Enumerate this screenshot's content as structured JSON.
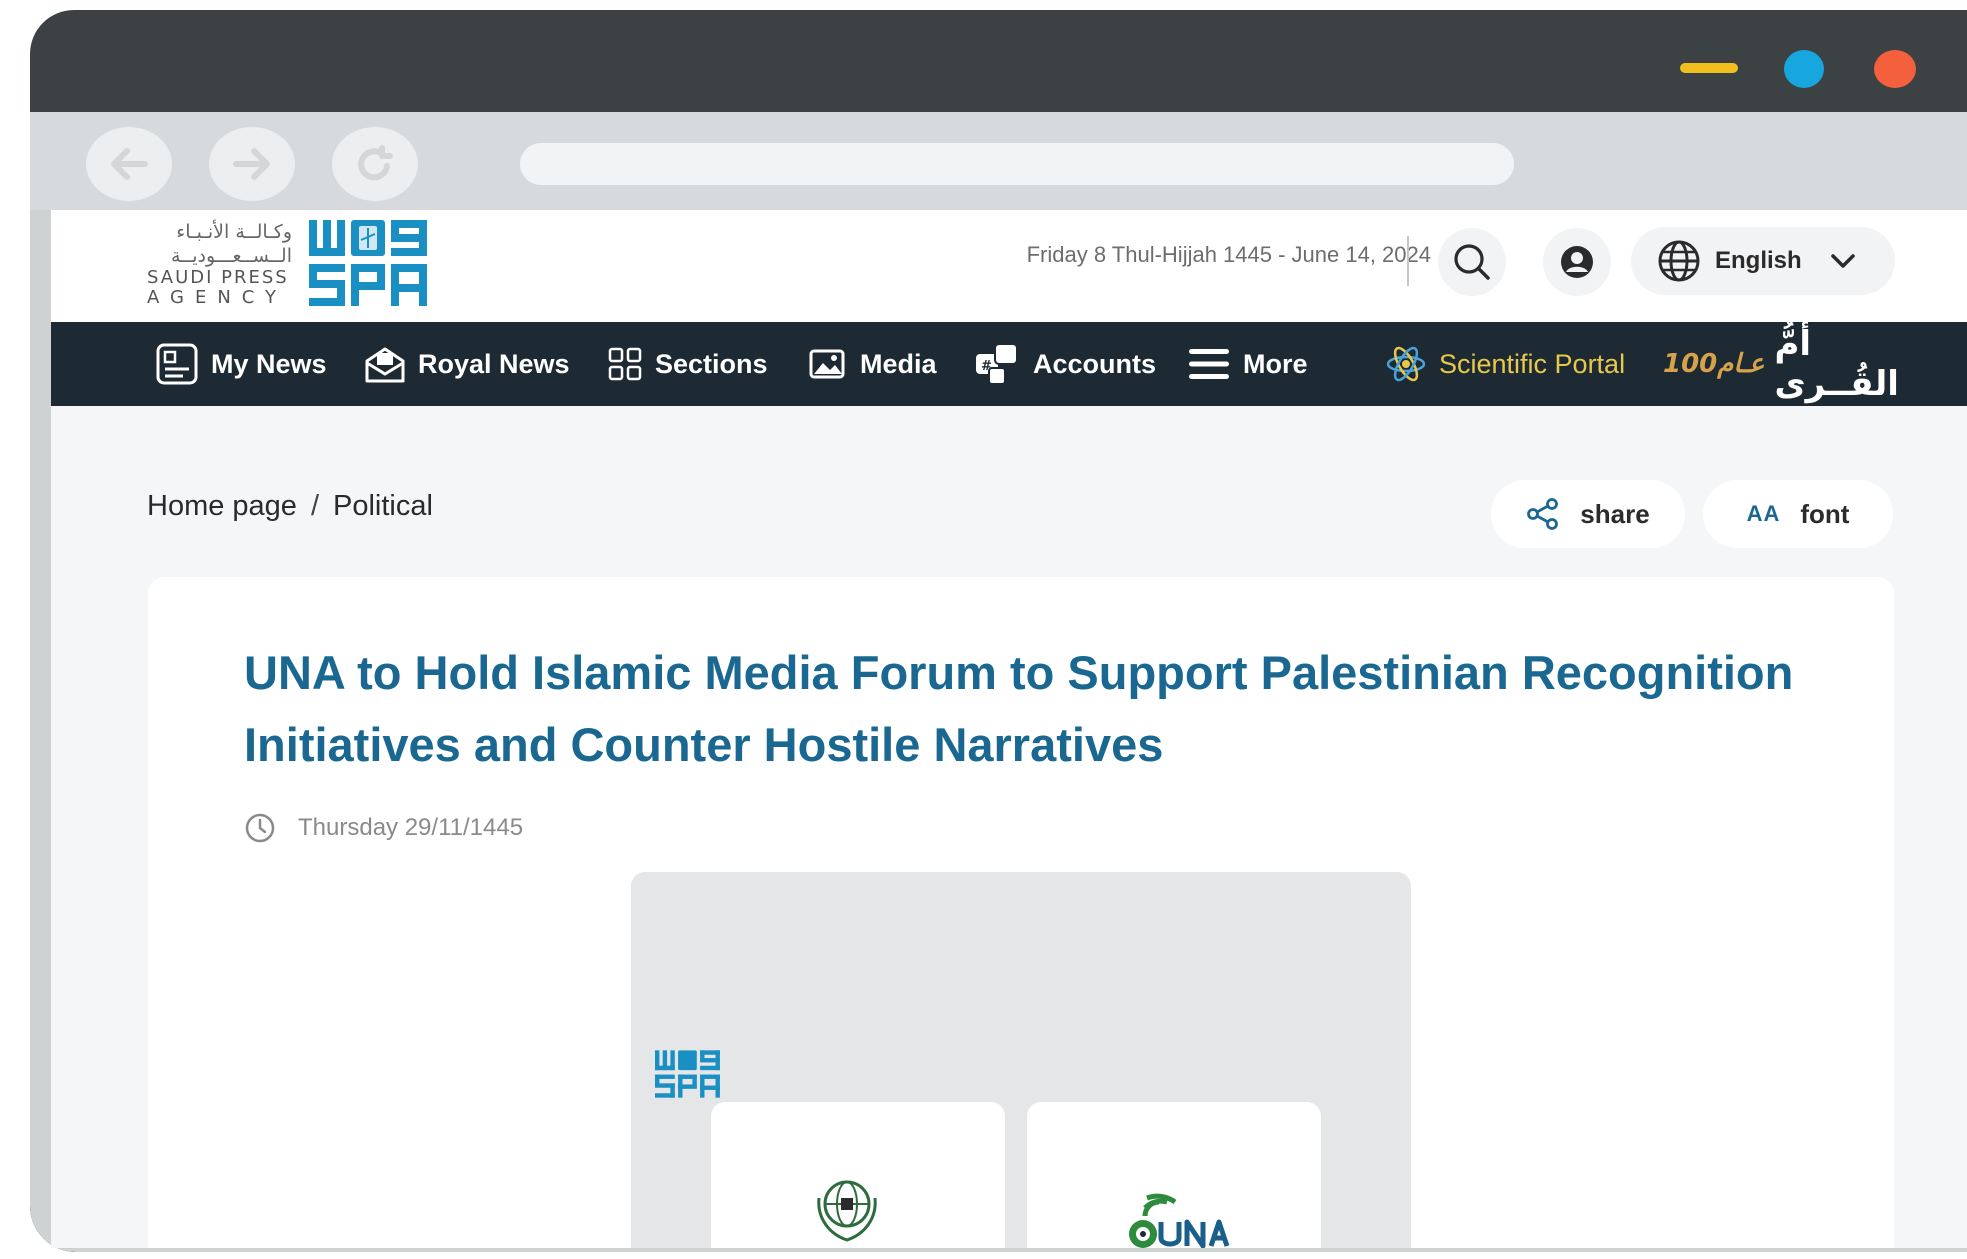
{
  "browser": {
    "window_controls": [
      "minimize",
      "maximize",
      "close"
    ],
    "nav_buttons": [
      {
        "name": "back-button",
        "icon": "arrow-left-icon"
      },
      {
        "name": "forward-button",
        "icon": "arrow-right-icon"
      },
      {
        "name": "reload-button",
        "icon": "reload-icon"
      }
    ]
  },
  "site": {
    "logo_arabic_line1": "وكـالــة الأنـبـاء",
    "logo_arabic_line2": "الــســعـــوديــة",
    "logo_en_line1": "SAUDI PRESS",
    "logo_en_line2": "AGENCY",
    "date_text": "Friday 8 Thul-Hijjah 1445 - June 14, 2024",
    "language": "English"
  },
  "menu": {
    "items": [
      {
        "label": "My News",
        "icon": "news-icon"
      },
      {
        "label": "Royal News",
        "icon": "envelope-icon"
      },
      {
        "label": "Sections",
        "icon": "grid-icon"
      },
      {
        "label": "Media",
        "icon": "image-icon"
      },
      {
        "label": "Accounts",
        "icon": "social-icon"
      },
      {
        "label": "More",
        "icon": "menu-icon"
      }
    ],
    "scientific_portal": "Scientific Portal",
    "umm_alqura": "أمُّ القُــرى",
    "umm_100": "100عـام"
  },
  "breadcrumb": {
    "home": "Home page",
    "separator": "/",
    "current": "Political"
  },
  "actions": {
    "share": "share",
    "font": "font",
    "font_icon_text": "AA"
  },
  "article": {
    "title": "UNA to Hold Islamic Media Forum to Support Palestinian Recognition Initiatives and Counter Hostile Narratives",
    "date": "Thursday 29/11/1445"
  },
  "colors": {
    "accent": "#1a6891",
    "nav_bg": "#1d2933",
    "portal": "#e7c84a"
  }
}
